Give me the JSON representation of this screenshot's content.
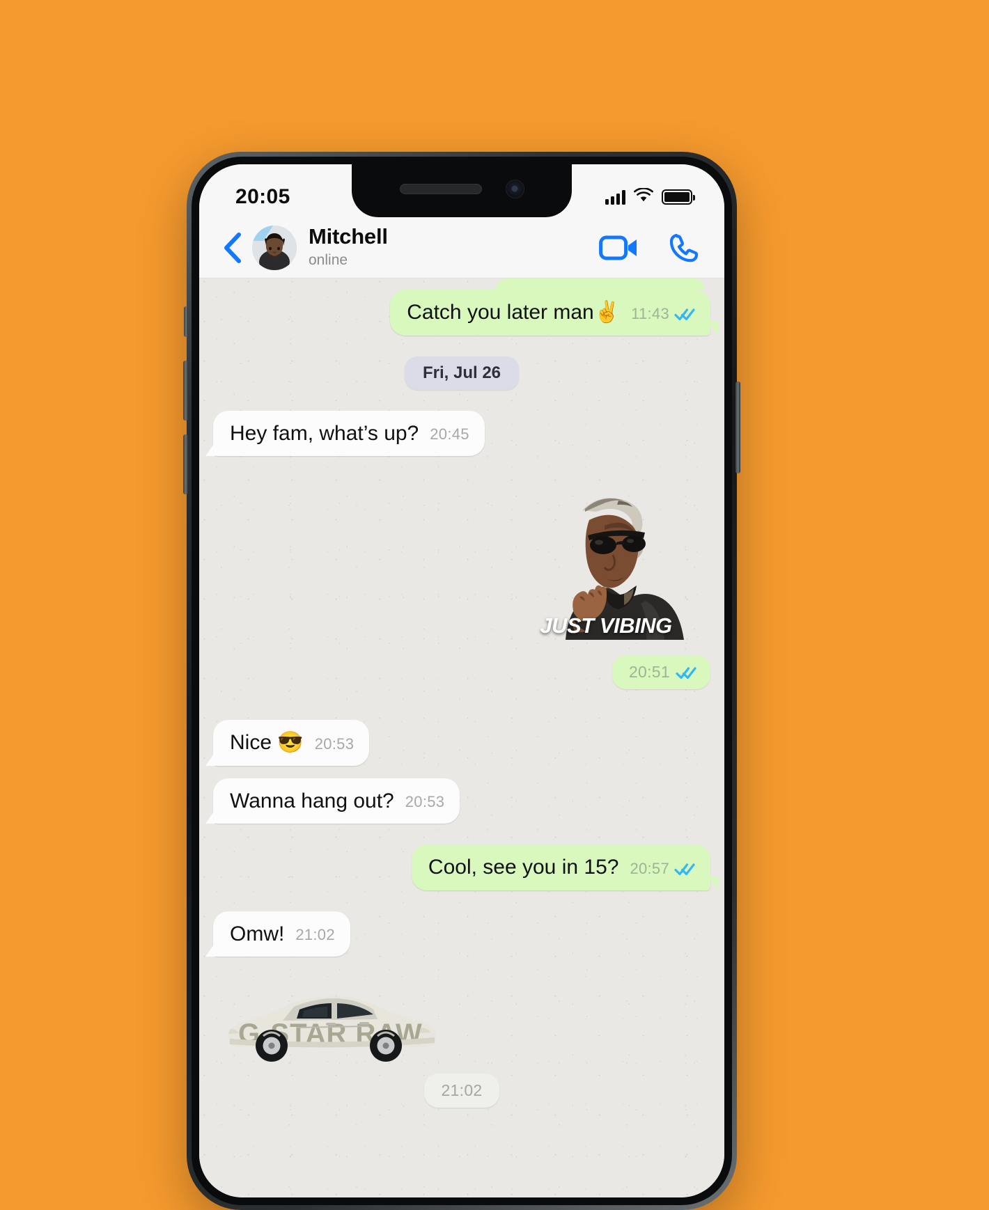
{
  "status_bar": {
    "time": "20:05",
    "signal_icon": "cellular-signal-icon",
    "wifi_icon": "wifi-icon",
    "battery_icon": "battery-full-icon"
  },
  "header": {
    "back_icon": "chevron-left-icon",
    "avatar_name": "contact-avatar",
    "contact_name": "Mitchell",
    "presence": "online",
    "video_call_icon": "video-camera-icon",
    "voice_call_icon": "phone-icon"
  },
  "colors": {
    "page_background": "#F59A2E",
    "accent_blue": "#1478FF",
    "outgoing_bubble": "#D9F8BE",
    "incoming_bubble": "#FCFCFC",
    "chat_background": "#E9E8E4",
    "date_chip": "#DCDCE8",
    "tick_blue": "#34B7F1"
  },
  "messages": [
    {
      "id": "msg-catch-you-later",
      "type": "text",
      "direction": "out",
      "text": "Catch you later man✌️",
      "time": "11:43",
      "status": "read"
    },
    {
      "id": "date-divider",
      "type": "date",
      "label": "Fri, Jul 26"
    },
    {
      "id": "msg-hey-fam",
      "type": "text",
      "direction": "in",
      "text": "Hey fam, what’s up?",
      "time": "20:45"
    },
    {
      "id": "msg-gif-just-vibing",
      "type": "media",
      "direction": "out",
      "media_kind": "gif",
      "caption_overlay": "JUST VIBING",
      "time": "20:51",
      "status": "read"
    },
    {
      "id": "msg-nice",
      "type": "text",
      "direction": "in",
      "text": "Nice 😎",
      "time": "20:53"
    },
    {
      "id": "msg-wanna-hang-out",
      "type": "text",
      "direction": "in",
      "text": "Wanna hang out?",
      "time": "20:53"
    },
    {
      "id": "msg-cool-see-you",
      "type": "text",
      "direction": "out",
      "text": "Cool, see you in 15?",
      "time": "20:57",
      "status": "read"
    },
    {
      "id": "msg-omw",
      "type": "text",
      "direction": "in",
      "text": "Omw!",
      "time": "21:02"
    },
    {
      "id": "msg-sticker-car",
      "type": "media",
      "direction": "in",
      "media_kind": "sticker",
      "caption_overlay": "G-STAR RAW",
      "time": "21:02"
    }
  ]
}
